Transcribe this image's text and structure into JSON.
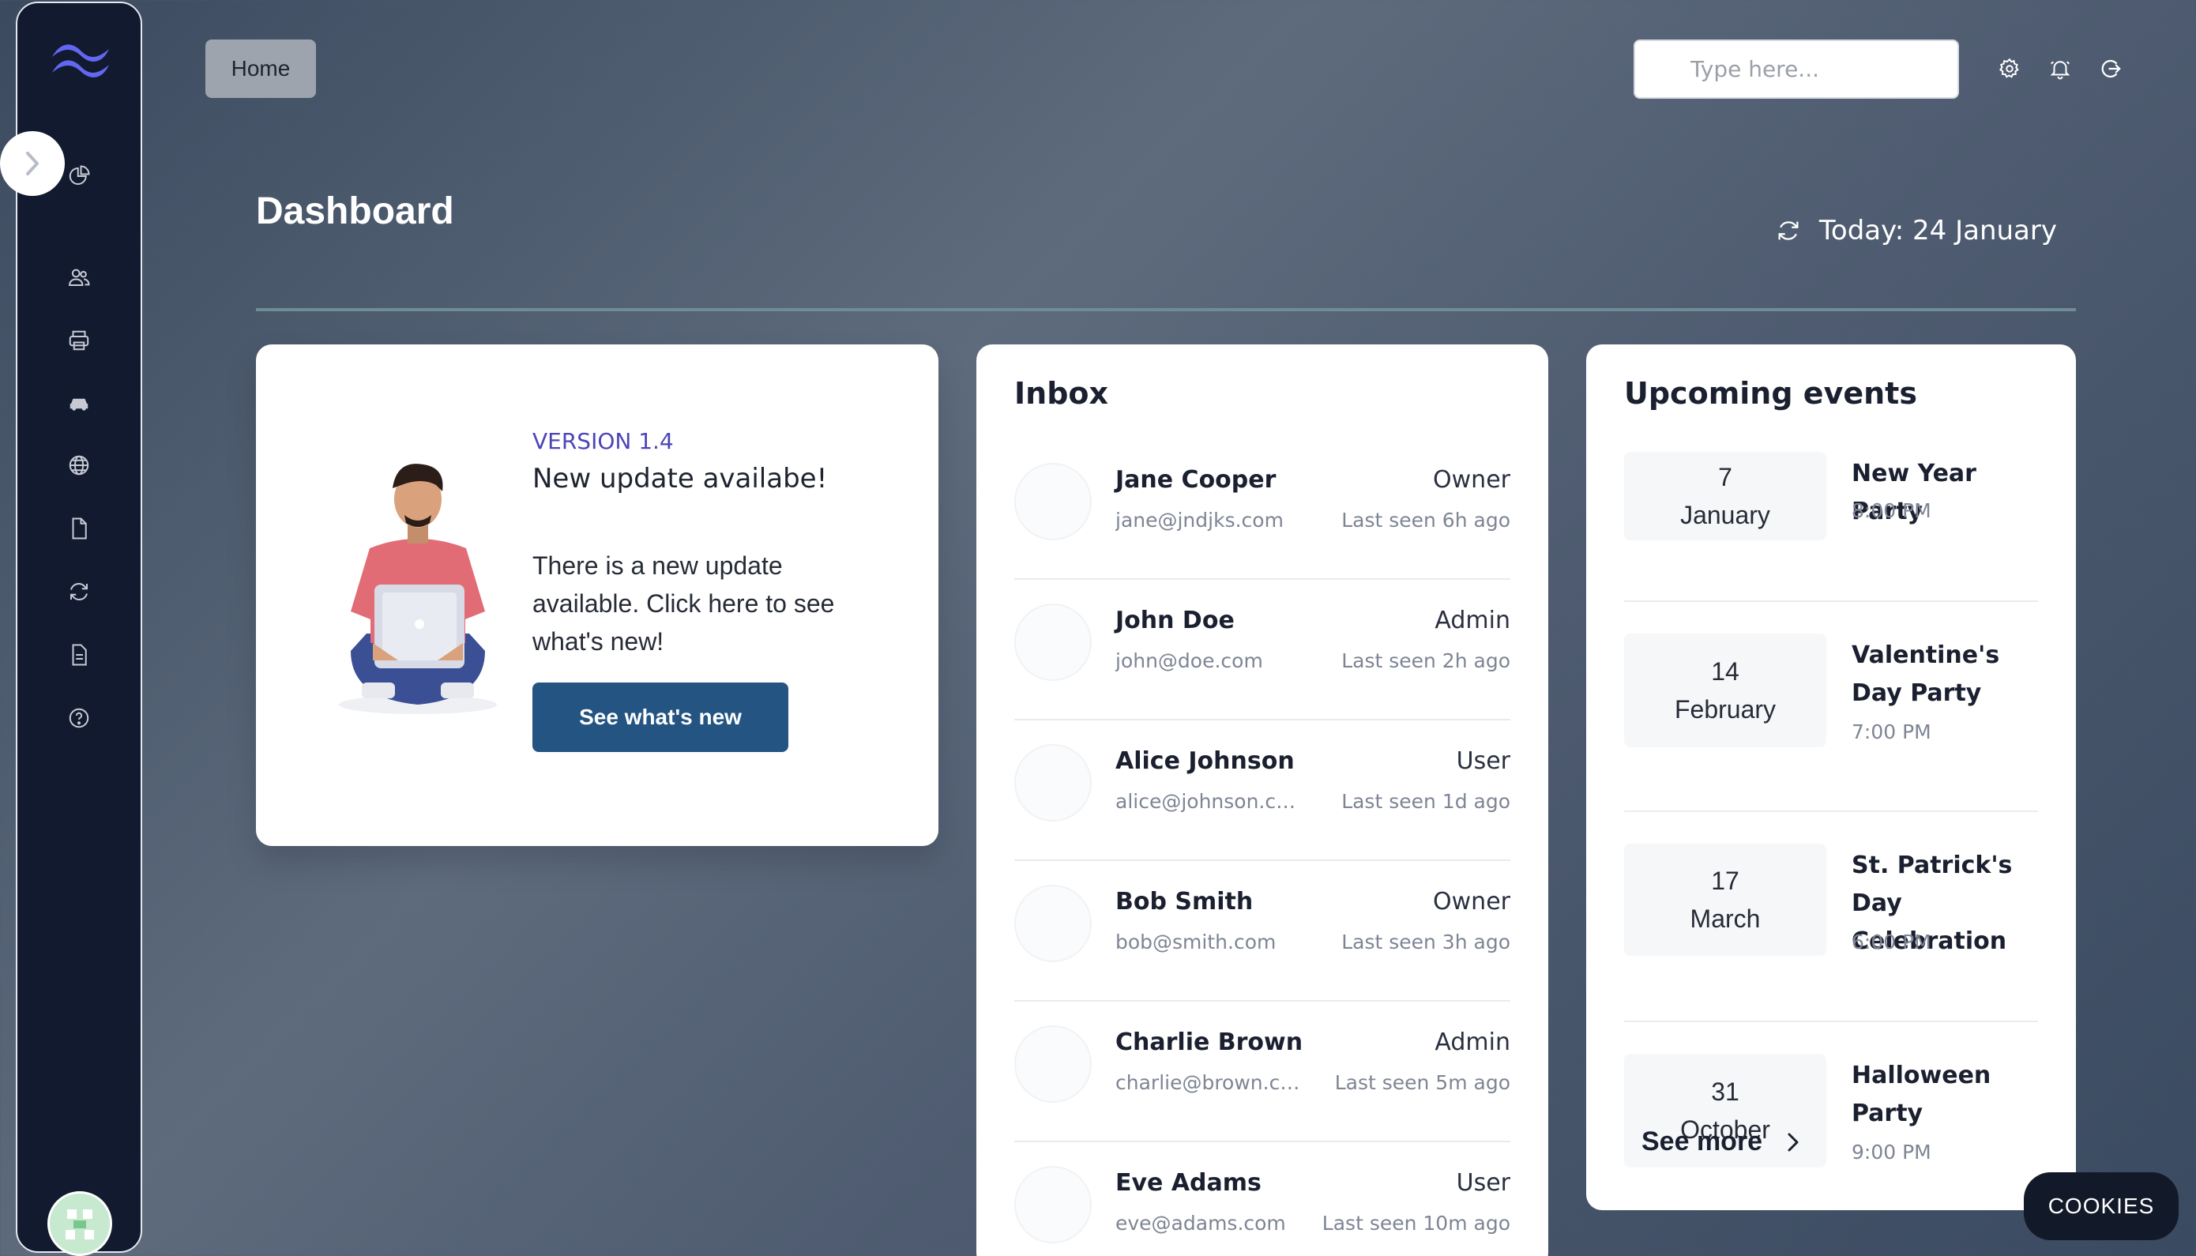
{
  "topbar": {
    "home_label": "Home",
    "search_placeholder": "Type here..."
  },
  "header": {
    "title": "Dashboard",
    "today": "Today: 24 January"
  },
  "sidebar": {
    "icons": [
      "chart-pie-icon",
      "users-icon",
      "printer-icon",
      "car-icon",
      "globe-icon",
      "document-icon",
      "refresh-icon",
      "file-text-icon",
      "help-icon"
    ]
  },
  "update": {
    "version": "VERSION 1.4",
    "title": "New update availabe!",
    "body": "There is a new update available. Click here to see what's new!",
    "button": "See what's new"
  },
  "inbox": {
    "title": "Inbox",
    "items": [
      {
        "name": "Jane Cooper",
        "email": "jane@jndjks.com",
        "role": "Owner",
        "last_seen": "Last seen 6h ago"
      },
      {
        "name": "John Doe",
        "email": "john@doe.com",
        "role": "Admin",
        "last_seen": "Last seen 2h ago"
      },
      {
        "name": "Alice Johnson",
        "email": "alice@johnson.com",
        "role": "User",
        "last_seen": "Last seen 1d ago"
      },
      {
        "name": "Bob Smith",
        "email": "bob@smith.com",
        "role": "Owner",
        "last_seen": "Last seen 3h ago"
      },
      {
        "name": "Charlie Brown",
        "email": "charlie@brown.co...",
        "role": "Admin",
        "last_seen": "Last seen 5m ago"
      },
      {
        "name": "Eve Adams",
        "email": "eve@adams.com",
        "role": "User",
        "last_seen": "Last seen 10m ago"
      }
    ]
  },
  "events": {
    "title": "Upcoming events",
    "items": [
      {
        "day": "7",
        "month": "January",
        "name": "New Year Party",
        "time": "8:00 PM"
      },
      {
        "day": "14",
        "month": "February",
        "name": "Valentine's Day Party",
        "time": "7:00 PM"
      },
      {
        "day": "17",
        "month": "March",
        "name": "St. Patrick's Day Celebration",
        "time": "6:00 PM"
      },
      {
        "day": "31",
        "month": "October",
        "name": "Halloween Party",
        "time": "9:00 PM"
      }
    ],
    "see_more": "See more"
  },
  "cookies_label": "COOKIES",
  "colors": {
    "sidebar_bg": "#111a2e",
    "primary_button": "#245482",
    "version_accent": "#4b45b8",
    "logo": "#6366f1"
  }
}
